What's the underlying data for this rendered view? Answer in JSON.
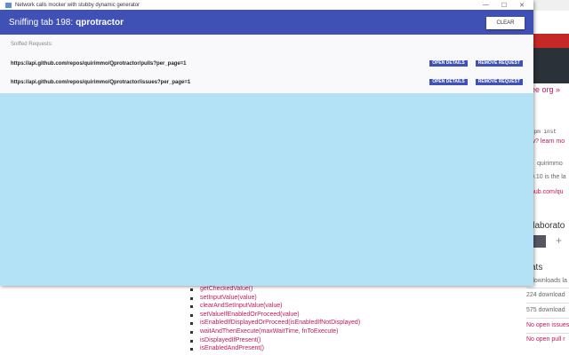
{
  "window": {
    "title": "Network calls mocker with stubby dynamic generator",
    "controls": [
      "—",
      "☐",
      "✕"
    ]
  },
  "header": {
    "prefix": "Sniffing tab 198:",
    "tab_name": "qprotractor",
    "clear_label": "CLEAR"
  },
  "content": {
    "label": "Sniffed Requests:",
    "requests": [
      {
        "url": "https://api.github.com/repos/quirimmo/Qprotractor/pulls?per_page=1",
        "open": "OPEN DETAILS",
        "remove": "REMOVE REQUEST"
      },
      {
        "url": "https://api.github.com/repos/quirimmo/Qprotractor/issues?per_page=1",
        "open": "OPEN DETAILS",
        "remove": "REMOVE REQUEST"
      }
    ]
  },
  "background": {
    "side": [
      "ee org »",
      "npm inst",
      "w? learn mo",
      "quirimmo",
      "0.10 is the la",
      "hub.com/qu",
      "llaborato",
      "ats",
      "downloads la",
      "224 download",
      "575 download",
      "No open issues",
      "No open pull r"
    ],
    "api": [
      "getCheckedValue()",
      "setInputValue(value)",
      "clearAndSetInputValue(value)",
      "setValueIfEnabledOrProceed(value)",
      "isEnabledIfDisplayedOrProceed(isEnabledIfNotDisplayed)",
      "waitAndThenExecute(maxWaitTime, fnToExecute)",
      "isDisplayedIfPresent()",
      "isEnabledAndPresent()"
    ]
  }
}
